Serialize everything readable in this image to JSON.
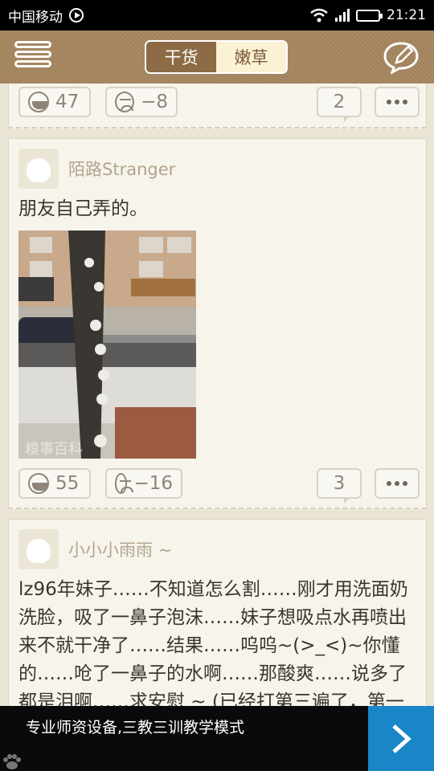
{
  "statusbar": {
    "carrier": "中国移动",
    "time": "21:21"
  },
  "header": {
    "tabs": [
      {
        "label": "干货",
        "active": true
      },
      {
        "label": "嫩草",
        "active": false
      }
    ]
  },
  "posts": [
    {
      "likes": "47",
      "dislikes": "−8",
      "comments": "2"
    },
    {
      "author": "陌路Stranger",
      "text": "朋友自己弄的。",
      "image_watermark": "糗事百科",
      "likes": "55",
      "dislikes": "−16",
      "comments": "3"
    },
    {
      "author": "小小小雨雨 ~",
      "text": "lz96年妹子……不知道怎么割……刚才用洗面奶洗脸，吸了一鼻子泡沫……妹子想吸点水再喷出来不就干净了……结果……呜呜~(>_<)~你懂的……呛了一鼻子的水啊……那酸爽……说多了都是泪啊……求安慰 ~ (已经打第三遍了，第一"
    }
  ],
  "ad": {
    "text": "专业师资设备,三教三训教学模式"
  },
  "colors": {
    "header": "#a58660",
    "active_tab": "#8c6b45",
    "ad_arrow": "#1a86c7"
  }
}
